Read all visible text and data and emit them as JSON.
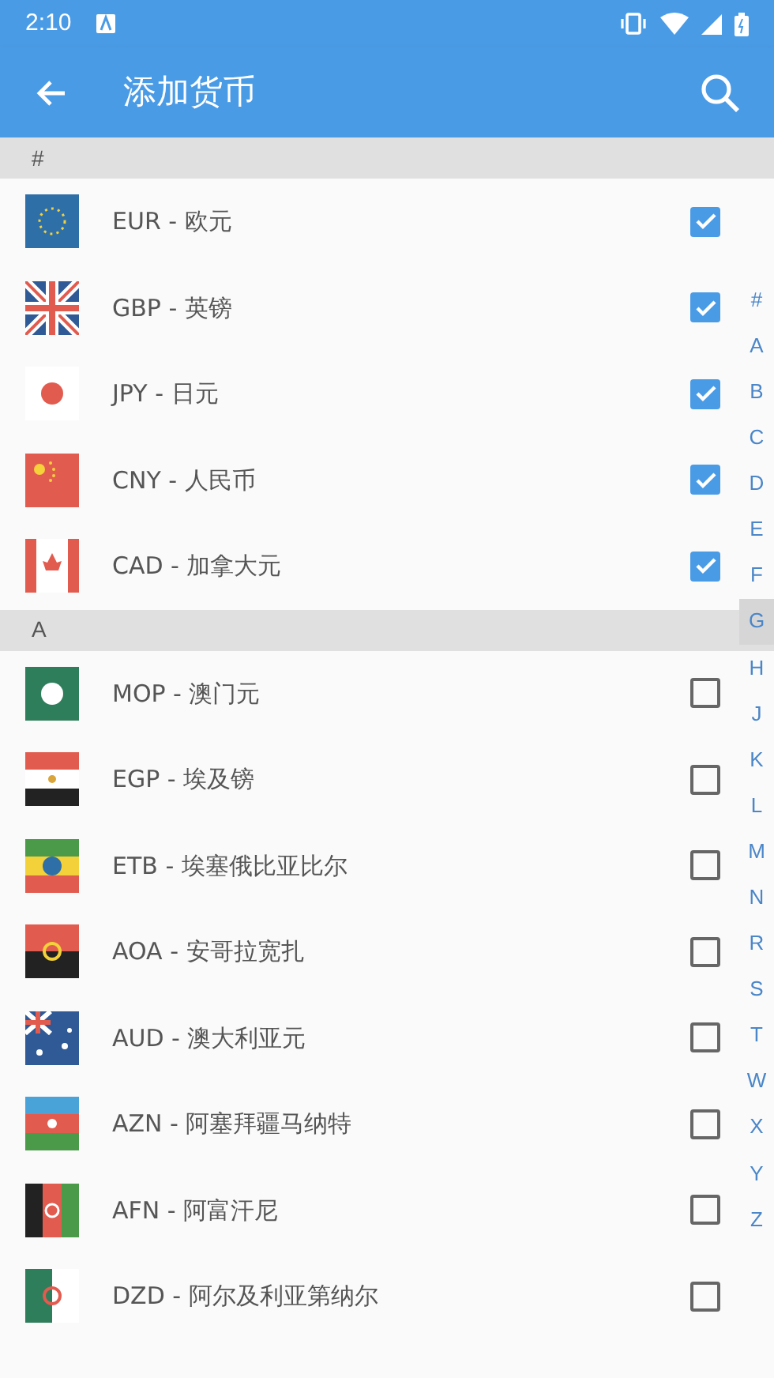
{
  "status_bar": {
    "time": "2:10"
  },
  "app_bar": {
    "title": "添加货币"
  },
  "sections": [
    {
      "header": "#",
      "items": [
        {
          "label": "EUR - 欧元",
          "checked": true
        },
        {
          "label": "GBP - 英镑",
          "checked": true
        },
        {
          "label": "JPY - 日元",
          "checked": true
        },
        {
          "label": "CNY - 人民币",
          "checked": true
        },
        {
          "label": "CAD - 加拿大元",
          "checked": true
        }
      ]
    },
    {
      "header": "A",
      "items": [
        {
          "label": "MOP - 澳门元",
          "checked": false
        },
        {
          "label": "EGP - 埃及镑",
          "checked": false
        },
        {
          "label": "ETB - 埃塞俄比亚比尔",
          "checked": false
        },
        {
          "label": "AOA - 安哥拉宽扎",
          "checked": false
        },
        {
          "label": "AUD - 澳大利亚元",
          "checked": false
        },
        {
          "label": "AZN - 阿塞拜疆马纳特",
          "checked": false
        },
        {
          "label": "AFN - 阿富汗尼",
          "checked": false
        },
        {
          "label": "DZD - 阿尔及利亚第纳尔",
          "checked": false
        }
      ]
    }
  ],
  "index": [
    {
      "letter": "#",
      "selected": false
    },
    {
      "letter": "A",
      "selected": false
    },
    {
      "letter": "B",
      "selected": false
    },
    {
      "letter": "C",
      "selected": false
    },
    {
      "letter": "D",
      "selected": false
    },
    {
      "letter": "E",
      "selected": false
    },
    {
      "letter": "F",
      "selected": false
    },
    {
      "letter": "G",
      "selected": true
    },
    {
      "letter": "H",
      "selected": false
    },
    {
      "letter": "J",
      "selected": false
    },
    {
      "letter": "K",
      "selected": false
    },
    {
      "letter": "L",
      "selected": false
    },
    {
      "letter": "M",
      "selected": false
    },
    {
      "letter": "N",
      "selected": false
    },
    {
      "letter": "R",
      "selected": false
    },
    {
      "letter": "S",
      "selected": false
    },
    {
      "letter": "T",
      "selected": false
    },
    {
      "letter": "W",
      "selected": false
    },
    {
      "letter": "X",
      "selected": false
    },
    {
      "letter": "Y",
      "selected": false
    },
    {
      "letter": "Z",
      "selected": false
    }
  ]
}
